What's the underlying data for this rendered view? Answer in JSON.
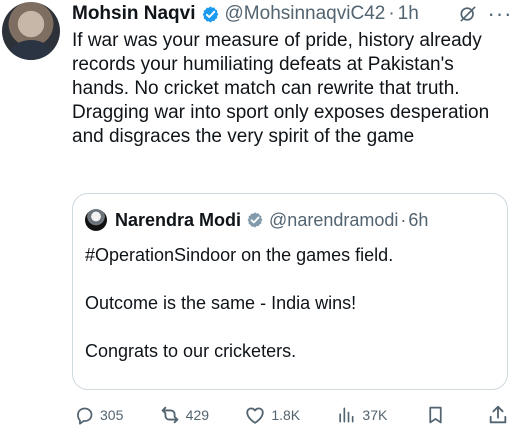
{
  "tweet": {
    "author": {
      "name": "Mohsin Naqvi",
      "handle": "@MohsinnaqviC42",
      "time": "1h",
      "separator": "·"
    },
    "text": "If war was your measure of pride, history already records your humiliating defeats at Pakistan's hands. No cricket match can rewrite that truth. Dragging war into sport only exposes desperation and disgraces the very spirit of the game",
    "quoted": {
      "name": "Narendra Modi",
      "handle": "@narendramodi",
      "separator": "·",
      "time": "6h",
      "text": "#OperationSindoor on the games field.\n\nOutcome is the same - India wins!\n\nCongrats to our cricketers."
    },
    "actions": {
      "replies": "305",
      "reposts": "429",
      "likes": "1.8K",
      "views": "37K"
    },
    "colors": {
      "accent": "#1d9bf0",
      "text": "#0f1419",
      "secondary": "#536471",
      "border": "#cfd9de"
    },
    "icons": {
      "verified": "verified-badge-icon",
      "grok": "grok-icon",
      "more": "more-options-icon",
      "reply": "reply-icon",
      "repost": "repost-icon",
      "like": "like-icon",
      "views": "views-icon",
      "bookmark": "bookmark-icon",
      "share": "share-icon"
    }
  }
}
